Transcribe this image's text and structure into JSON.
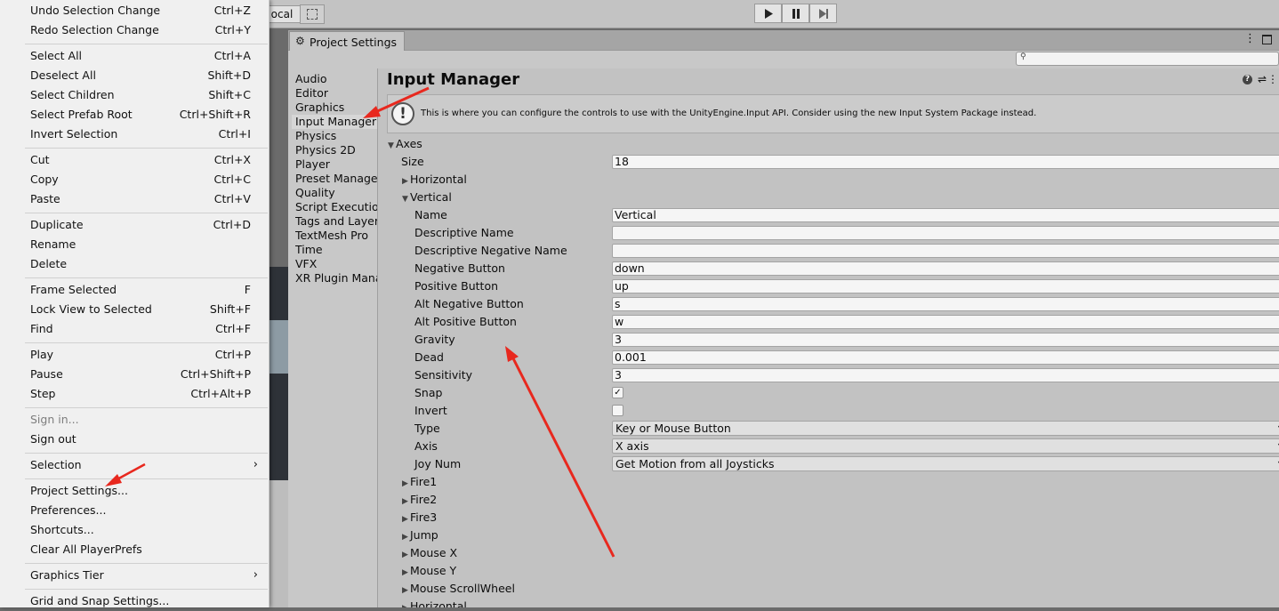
{
  "background": {
    "local_label": "ocal"
  },
  "edit_menu": {
    "items": [
      {
        "label": "Undo Selection Change",
        "shortcut": "Ctrl+Z"
      },
      {
        "label": "Redo Selection Change",
        "shortcut": "Ctrl+Y"
      },
      {
        "label": "Select All",
        "shortcut": "Ctrl+A"
      },
      {
        "label": "Deselect All",
        "shortcut": "Shift+D"
      },
      {
        "label": "Select Children",
        "shortcut": "Shift+C"
      },
      {
        "label": "Select Prefab Root",
        "shortcut": "Ctrl+Shift+R"
      },
      {
        "label": "Invert Selection",
        "shortcut": "Ctrl+I"
      },
      {
        "label": "Cut",
        "shortcut": "Ctrl+X"
      },
      {
        "label": "Copy",
        "shortcut": "Ctrl+C"
      },
      {
        "label": "Paste",
        "shortcut": "Ctrl+V"
      },
      {
        "label": "Duplicate",
        "shortcut": "Ctrl+D"
      },
      {
        "label": "Rename",
        "shortcut": ""
      },
      {
        "label": "Delete",
        "shortcut": ""
      },
      {
        "label": "Frame Selected",
        "shortcut": "F"
      },
      {
        "label": "Lock View to Selected",
        "shortcut": "Shift+F"
      },
      {
        "label": "Find",
        "shortcut": "Ctrl+F"
      },
      {
        "label": "Play",
        "shortcut": "Ctrl+P"
      },
      {
        "label": "Pause",
        "shortcut": "Ctrl+Shift+P"
      },
      {
        "label": "Step",
        "shortcut": "Ctrl+Alt+P"
      },
      {
        "label": "Sign in...",
        "shortcut": ""
      },
      {
        "label": "Sign out",
        "shortcut": ""
      },
      {
        "label": "Selection",
        "shortcut": ""
      },
      {
        "label": "Project Settings...",
        "shortcut": ""
      },
      {
        "label": "Preferences...",
        "shortcut": ""
      },
      {
        "label": "Shortcuts...",
        "shortcut": ""
      },
      {
        "label": "Clear All PlayerPrefs",
        "shortcut": ""
      },
      {
        "label": "Graphics Tier",
        "shortcut": ""
      },
      {
        "label": "Grid and Snap Settings...",
        "shortcut": ""
      }
    ]
  },
  "project_settings": {
    "tab_title": "Project Settings",
    "sidebar": [
      "Audio",
      "Editor",
      "Graphics",
      "Input Manager",
      "Physics",
      "Physics 2D",
      "Player",
      "Preset Manager",
      "Quality",
      "Script Execution",
      "Tags and Layers",
      "TextMesh Pro",
      "Time",
      "VFX",
      "XR Plugin Manag"
    ],
    "selected_sidebar": "Input Manager",
    "title": "Input Manager",
    "info_text": "This is where you can configure the controls to use with the UnityEngine.Input API. Consider using the new Input System Package instead.",
    "axes_label": "Axes",
    "size_label": "Size",
    "size_value": "18",
    "horizontal_label": "Horizontal",
    "vertical_label": "Vertical",
    "fields": {
      "name": {
        "label": "Name",
        "value": "Vertical"
      },
      "descriptive_name": {
        "label": "Descriptive Name",
        "value": ""
      },
      "descriptive_negative_name": {
        "label": "Descriptive Negative Name",
        "value": ""
      },
      "negative_button": {
        "label": "Negative Button",
        "value": "down"
      },
      "positive_button": {
        "label": "Positive Button",
        "value": "up"
      },
      "alt_negative_button": {
        "label": "Alt Negative Button",
        "value": "s"
      },
      "alt_positive_button": {
        "label": "Alt Positive Button",
        "value": "w"
      },
      "gravity": {
        "label": "Gravity",
        "value": "3"
      },
      "dead": {
        "label": "Dead",
        "value": "0.001"
      },
      "sensitivity": {
        "label": "Sensitivity",
        "value": "3"
      },
      "snap": {
        "label": "Snap",
        "checked": "✓"
      },
      "invert": {
        "label": "Invert",
        "checked": ""
      },
      "type": {
        "label": "Type",
        "value": "Key or Mouse Button"
      },
      "axis": {
        "label": "Axis",
        "value": "X axis"
      },
      "joy_num": {
        "label": "Joy Num",
        "value": "Get Motion from all Joysticks"
      }
    },
    "more_axes": [
      "Fire1",
      "Fire2",
      "Fire3",
      "Jump",
      "Mouse X",
      "Mouse Y",
      "Mouse ScrollWheel",
      "Horizontal"
    ]
  },
  "colors": {
    "annotation_arrow": "#e8281e",
    "menu_bg": "#f0f0f0",
    "panel_bg": "#c2c2c2"
  }
}
